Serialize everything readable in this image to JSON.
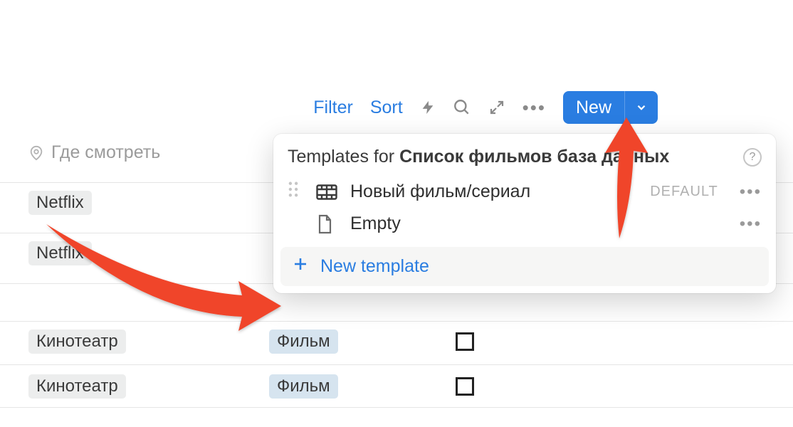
{
  "toolbar": {
    "filter": "Filter",
    "sort": "Sort",
    "new": "New"
  },
  "column": {
    "header": "Где смотреть"
  },
  "rows": [
    {
      "place": "Netflix",
      "type": null,
      "check": false
    },
    {
      "place": "Netflix",
      "type": null,
      "check": false
    },
    {
      "place": null,
      "type": null,
      "check": false
    },
    {
      "place": "Кинотеатр",
      "type": "Фильм",
      "check": false
    },
    {
      "place": "Кинотеатр",
      "type": "Фильм",
      "check": false
    }
  ],
  "popover": {
    "title_prefix": "Templates for",
    "title_bold": "Список фильмов база данных",
    "default_label": "DEFAULT",
    "templates": [
      {
        "name": "Новый фильм/сериал",
        "default": true,
        "icon": "film"
      },
      {
        "name": "Empty",
        "default": false,
        "icon": "page"
      }
    ],
    "new_template": "New template"
  }
}
